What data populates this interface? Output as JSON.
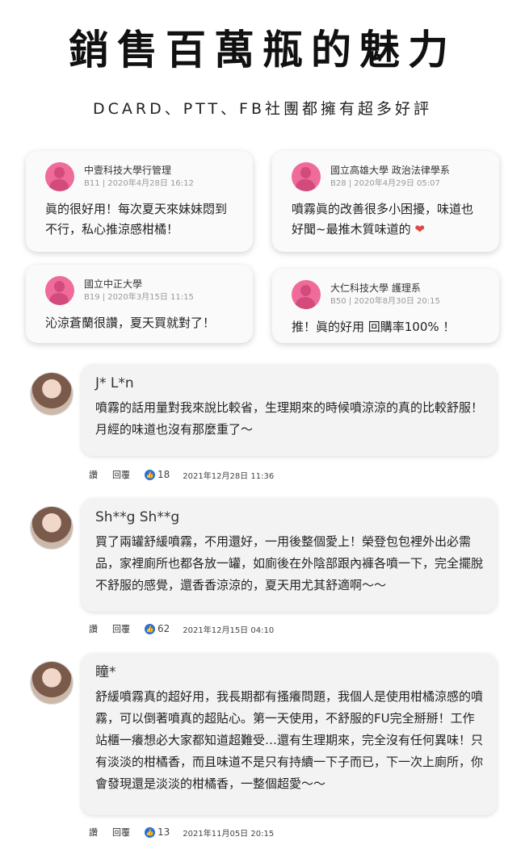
{
  "header": {
    "title": "銷售百萬瓶的魅力",
    "subtitle": "DCARD、PTT、FB社團都擁有超多好評"
  },
  "dcard_reviews": [
    {
      "school": "中壹科技大學行管理",
      "meta": "B11 | 2020年4月28日 16:12",
      "text": "眞的很好用！每次夏天來妹妹悶到不行，私心推涼感柑橘！"
    },
    {
      "school": "國立高雄大學 政治法律學系",
      "meta": "B28 | 2020年4月29日 05:07",
      "text": "噴霧眞的改善很多小困擾，味道也好聞~最推木質味道的",
      "heart": "❤"
    },
    {
      "school": "國立中正大學",
      "meta": "B19 | 2020年3月15日 11:15",
      "text": "沁涼蒼蘭很讚，夏天買就對了！"
    },
    {
      "school": "大仁科技大學 護理系",
      "meta": "B50 | 2020年8月30日 20:15",
      "text": "推！眞的好用 回購率100% ！"
    }
  ],
  "fb_comments": [
    {
      "name": "J* L*n",
      "text": "噴霧的話用量對我來說比較省，生理期來的時候噴涼涼的真的比較舒服！月經的味道也沒有那麼重了～",
      "like_label": "讚",
      "reply_label": "回覆",
      "likes": "18",
      "time": "2021年12月28日 11:36"
    },
    {
      "name": "Sh**g Sh**g",
      "text": "買了兩罐舒緩噴霧，不用還好，一用後整個愛上！榮登包包裡外出必需品，家裡廁所也都各放一罐，如廁後在外陰部跟內褲各噴一下，完全擺脫不舒服的感覺，還香香涼涼的，夏天用尤其舒適啊～～",
      "like_label": "讚",
      "reply_label": "回覆",
      "likes": "62",
      "time": "2021年12月15日 04:10"
    },
    {
      "name": "瞳*",
      "text": "舒緩噴霧真的超好用，我長期都有搔癢問題，我個人是使用柑橘涼感的噴霧，可以倒著噴真的超貼心。第一天使用，不舒服的FU完全掰掰！工作站櫃一癢想必大家都知道超難受…還有生理期來，完全沒有任何異味！只有淡淡的柑橘香，而且味道不是只有持續一下子而已，下一次上廁所，你會發現還是淡淡的柑橘香，一整個超愛～～",
      "like_label": "讚",
      "reply_label": "回覆",
      "likes": "13",
      "time": "2021年11月05日 20:15"
    }
  ]
}
